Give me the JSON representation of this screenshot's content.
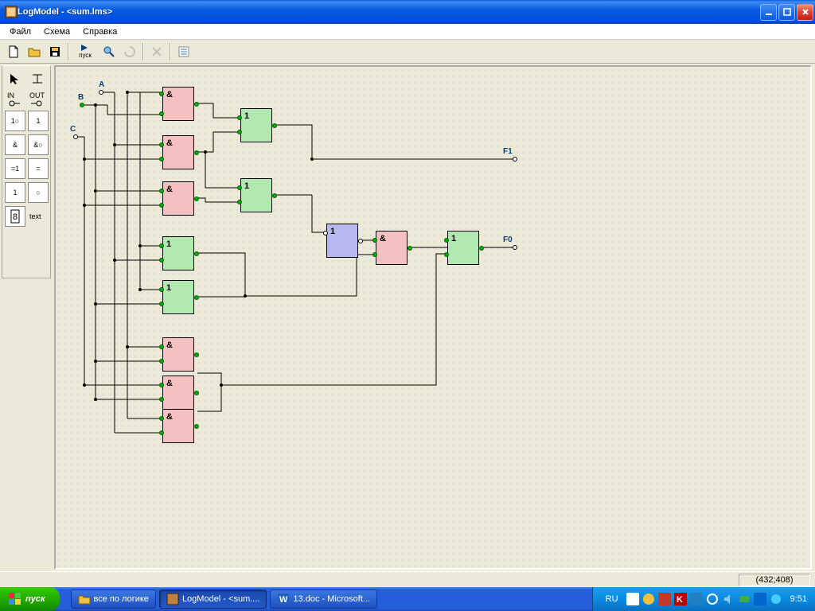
{
  "title": "LogModel - <sum.lms>",
  "menu": {
    "file": "Файл",
    "schema": "Схема",
    "help": "Справка"
  },
  "toolbar": {
    "run_label": "пуск"
  },
  "palette": {
    "in": "IN",
    "out": "OUT",
    "text": "text"
  },
  "inputs": {
    "a": "A",
    "b": "B",
    "c": "C"
  },
  "outputs": {
    "f1": "F1",
    "f0": "F0"
  },
  "gates": {
    "and": "&",
    "or": "1",
    "not": "1"
  },
  "status": {
    "coords": "(432;408)"
  },
  "taskbar": {
    "start": "пуск",
    "btn1": "все по логике",
    "btn2": "LogModel - <sum....",
    "btn3": "13.doc - Microsoft...",
    "lang": "RU",
    "clock": "9:51"
  }
}
